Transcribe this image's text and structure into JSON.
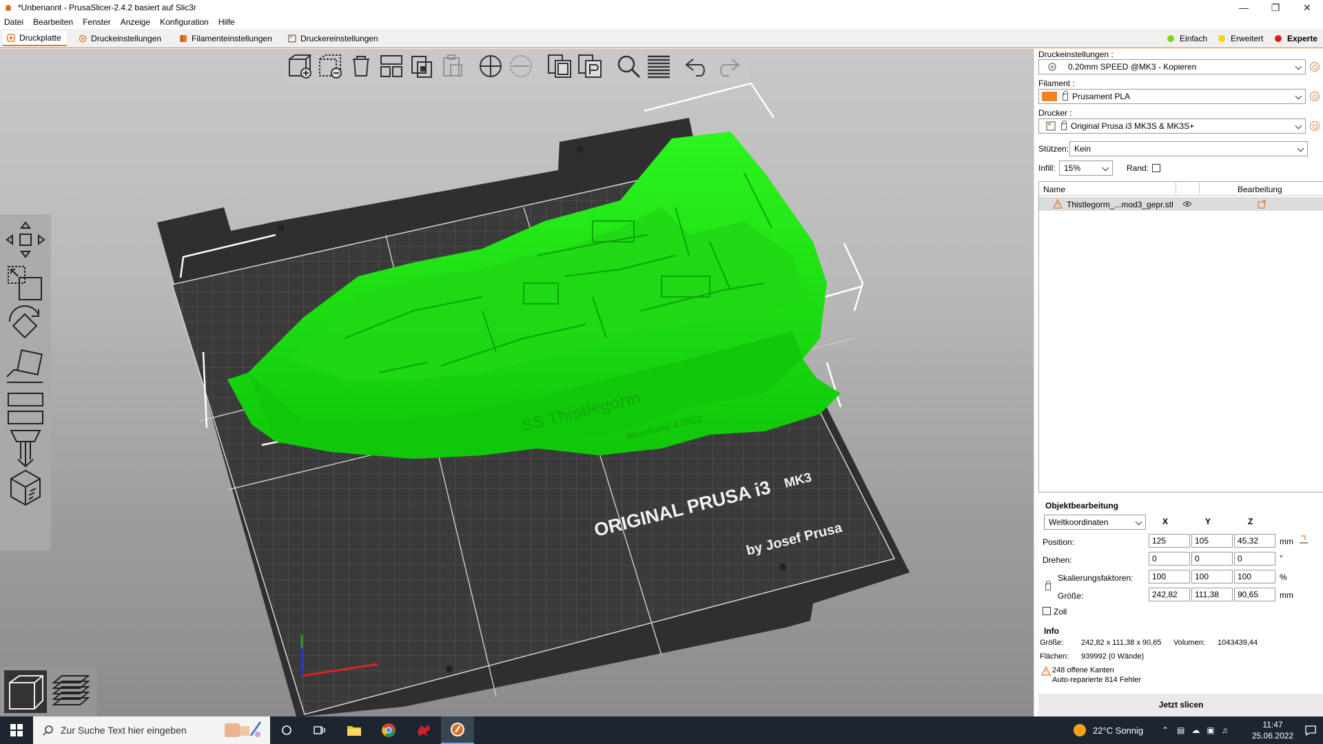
{
  "window": {
    "title": "*Unbenannt - PrusaSlicer-2.4.2 basiert auf Slic3r"
  },
  "menu": [
    "Datei",
    "Bearbeiten",
    "Fenster",
    "Anzeige",
    "Konfiguration",
    "Hilfe"
  ],
  "tabs": [
    {
      "label": "Druckplatte",
      "active": true
    },
    {
      "label": "Druckeinstellungen"
    },
    {
      "label": "Filamenteinstellungen"
    },
    {
      "label": "Druckereinstellungen"
    }
  ],
  "modes": {
    "simple": "Einfach",
    "advanced": "Erweitert",
    "expert": "Experte"
  },
  "colors": {
    "accent": "#e37a2e",
    "model": "#13e60c",
    "bed": "#3a3a3a"
  },
  "bed": {
    "brand_line1": "ORIGINAL PRUSA i3",
    "brand_suffix": "MK3",
    "brand_line2": "by Josef Prusa"
  },
  "model": {
    "hull_text": "SS Thistlegorm",
    "hull_subtext": "Wrecksite 4.2023"
  },
  "settings": {
    "print_label": "Druckeinstellungen :",
    "print_value": "0.20mm SPEED @MK3 - Kopieren",
    "filament_label": "Filament :",
    "filament_value": "Prusament PLA",
    "filament_color": "#f58220",
    "printer_label": "Drucker :",
    "printer_value": "Original Prusa i3 MK3S & MK3S+",
    "supports_label": "Stützen:",
    "supports_value": "Kein",
    "infill_label": "Infill:",
    "infill_value": "15%",
    "brim_label": "Rand:"
  },
  "object_list": {
    "col_name": "Name",
    "col_edit": "Bearbeitung",
    "items": [
      {
        "name": "Thistlegorm_...mod3_gepr.stl"
      }
    ]
  },
  "object_manipulation": {
    "title": "Objektbearbeitung",
    "coord_system": "Weltkoordinaten",
    "axes": [
      "X",
      "Y",
      "Z"
    ],
    "position_label": "Position:",
    "position": [
      "125",
      "105",
      "45,32"
    ],
    "position_unit": "mm",
    "rotation_label": "Drehen:",
    "rotation": [
      "0",
      "0",
      "0"
    ],
    "rotation_unit": "°",
    "scale_label": "Skalierungsfaktoren:",
    "scale": [
      "100",
      "100",
      "100"
    ],
    "scale_unit": "%",
    "size_label": "Größe:",
    "size": [
      "242,82",
      "111,38",
      "90,65"
    ],
    "size_unit": "mm",
    "inch_label": "Zoll"
  },
  "info": {
    "title": "Info",
    "size_label": "Größe:",
    "size_value": "242,82 x 111,38 x 90,65",
    "volume_label": "Volumen:",
    "volume_value": "1043439,44",
    "facets_label": "Flächen:",
    "facets_value": "939992 (0 Wände)",
    "warning_line1": "248 offene Kanten",
    "warning_line2": "Auto-reparierte 814 Fehler"
  },
  "slice_button": "Jetzt slicen",
  "taskbar": {
    "search_placeholder": "Zur Suche Text hier eingeben",
    "weather": "22°C  Sonnig",
    "time": "11:47",
    "date": "25.06.2022"
  }
}
